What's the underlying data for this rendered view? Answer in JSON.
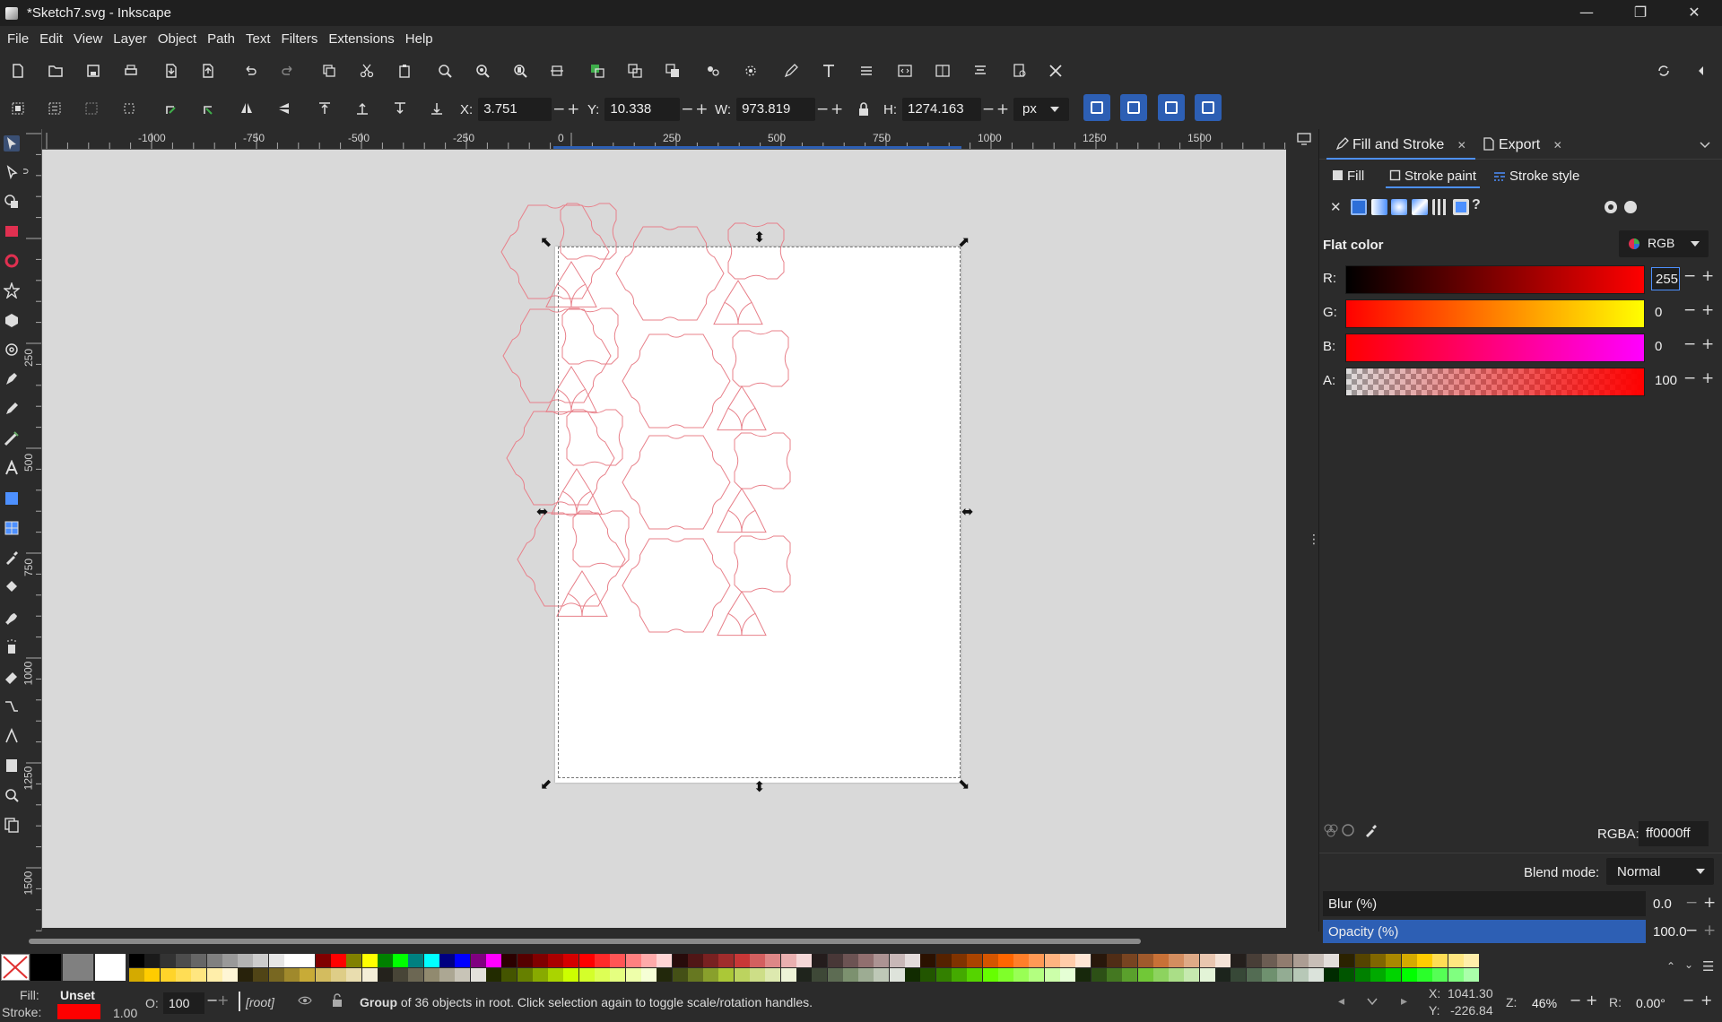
{
  "window": {
    "title": "*Sketch7.svg - Inkscape",
    "minimize": "—",
    "restore": "❐",
    "close": "✕"
  },
  "menu": [
    "File",
    "Edit",
    "View",
    "Layer",
    "Object",
    "Path",
    "Text",
    "Filters",
    "Extensions",
    "Help"
  ],
  "tool_controls": {
    "x_label": "X:",
    "x_value": "3.751",
    "y_label": "Y:",
    "y_value": "10.338",
    "w_label": "W:",
    "w_value": "973.819",
    "h_label": "H:",
    "h_value": "1274.163",
    "unit": "px"
  },
  "ruler": {
    "h_labels": [
      "-1000",
      "-750",
      "-500",
      "-250",
      "0",
      "250",
      "500",
      "750",
      "1000",
      "1250",
      "1500"
    ],
    "v_labels": [
      "0",
      "250",
      "500",
      "750",
      "1000",
      "1250",
      "1500"
    ]
  },
  "dock": {
    "tabs": [
      {
        "label": "Fill and Stroke"
      },
      {
        "label": "Export"
      }
    ],
    "tab_close": "✕",
    "subtabs": [
      {
        "label": "Fill"
      },
      {
        "label": "Stroke paint"
      },
      {
        "label": "Stroke style"
      }
    ],
    "unknown_paint": "?",
    "flat_color_label": "Flat color",
    "color_mode": "RGB",
    "channels": [
      {
        "label": "R:",
        "value": "255",
        "gradient": "linear-gradient(to right,#000000,#ff0000)"
      },
      {
        "label": "G:",
        "value": "0",
        "gradient": "linear-gradient(to right,#ff0000,#ffff00)"
      },
      {
        "label": "B:",
        "value": "0",
        "gradient": "linear-gradient(to right,#ff0000,#ff00ff)"
      },
      {
        "label": "A:",
        "value": "100",
        "gradient": "linear-gradient(to right,rgba(255,0,0,0),#ff0000)"
      }
    ],
    "rgba_label": "RGBA:",
    "rgba_value": "ff0000ff",
    "blend_label": "Blend mode:",
    "blend_value": "Normal",
    "blur_label": "Blur (%)",
    "blur_value": "0.0",
    "opacity_label": "Opacity (%)",
    "opacity_value": "100.0"
  },
  "status": {
    "fill_label": "Fill:",
    "fill_value": "Unset",
    "stroke_label": "Stroke:",
    "stroke_width": "1.00",
    "stroke_color": "#ff0000",
    "o_label": "O:",
    "o_value": "100",
    "layer": "[root]",
    "msg_bold": "Group",
    "msg_rest": " of 36 objects in root. Click selection again to toggle scale/rotation handles.",
    "cursor_x": "X:  1041.30",
    "cursor_y": "Y:   -226.84",
    "zoom_label": "Z:",
    "zoom_value": "46%",
    "rot_label": "R:",
    "rot_value": "0.00°"
  },
  "colors": {
    "accent": "#4d90fe",
    "selected_blue": "#2d5fb4",
    "shape_stroke": "#e8808a",
    "page": "#ffffff",
    "canvas": "#d9d9d9",
    "panel": "#2b2b2b"
  }
}
